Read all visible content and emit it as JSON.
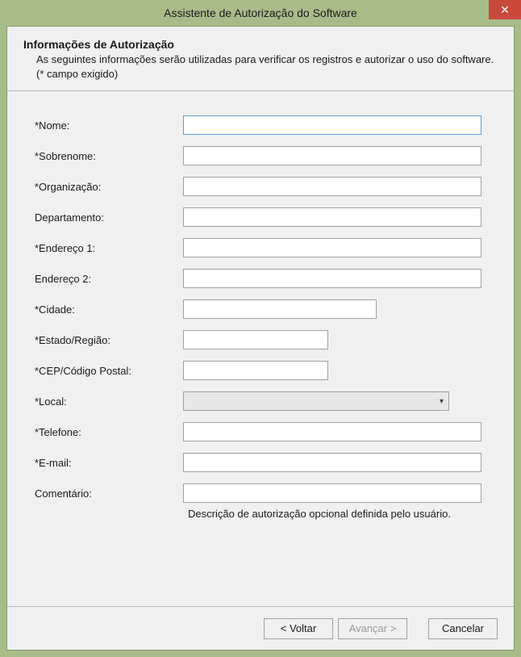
{
  "window": {
    "title": "Assistente de Autorização do Software"
  },
  "header": {
    "title": "Informações de Autorização",
    "description": "As seguintes informações serão utilizadas para verificar os registros e autorizar o uso do software. (* campo exigido)"
  },
  "form": {
    "nome_label": "*Nome:",
    "nome_value": "",
    "sobrenome_label": "*Sobrenome:",
    "sobrenome_value": "",
    "organizacao_label": "*Organização:",
    "organizacao_value": "",
    "departamento_label": "Departamento:",
    "departamento_value": "",
    "endereco1_label": "*Endereço 1:",
    "endereco1_value": "",
    "endereco2_label": "Endereço 2:",
    "endereco2_value": "",
    "cidade_label": "*Cidade:",
    "cidade_value": "",
    "estado_label": "*Estado/Região:",
    "estado_value": "",
    "cep_label": "*CEP/Código Postal:",
    "cep_value": "",
    "local_label": "*Local:",
    "local_value": "",
    "telefone_label": "*Telefone:",
    "telefone_value": "",
    "email_label": "*E-mail:",
    "email_value": "",
    "comentario_label": "Comentário:",
    "comentario_value": "",
    "comentario_hint": "Descrição de autorização opcional definida pelo usuário."
  },
  "buttons": {
    "back": "< Voltar",
    "next": "Avançar >",
    "cancel": "Cancelar"
  }
}
